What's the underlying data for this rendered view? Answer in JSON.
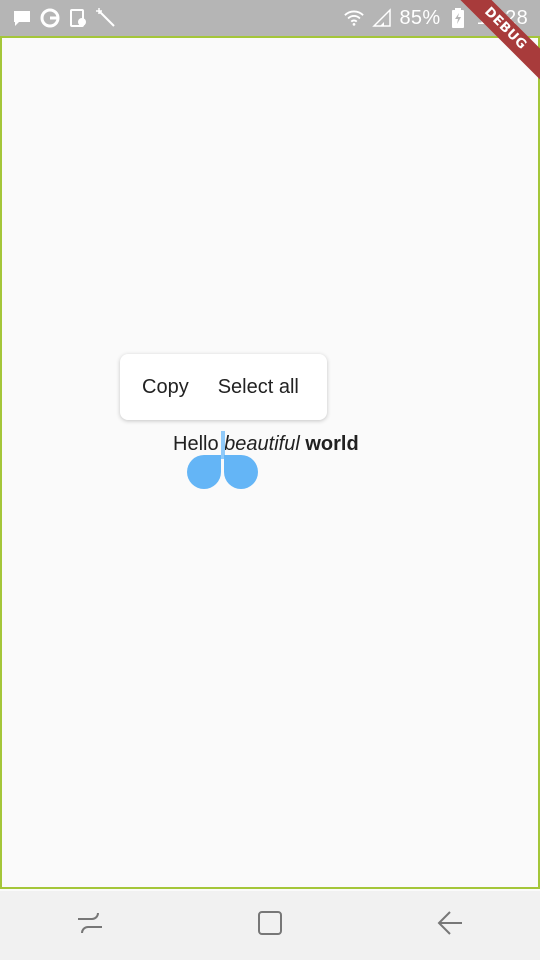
{
  "status_bar": {
    "battery": "85%",
    "time": "12:28",
    "left_icons": [
      "message-icon",
      "g-icon",
      "screen-record-icon",
      "magic-wand-icon"
    ],
    "right_icons": [
      "wifi-icon",
      "signal-icon",
      "battery-charging-icon"
    ]
  },
  "debug_banner": {
    "label": "DEBUG",
    "color": "#a83b3b"
  },
  "toolbar": {
    "copy_label": "Copy",
    "select_all_label": "Select all"
  },
  "text": {
    "part1": "Hello",
    "part2": "beautiful",
    "part3": "world"
  },
  "colors": {
    "handle": "#64b5f6",
    "caret": "#90caf9",
    "frame_border": "#a4c639"
  },
  "nav_bar": {
    "buttons": [
      "recents-icon",
      "home-icon",
      "back-icon"
    ]
  }
}
